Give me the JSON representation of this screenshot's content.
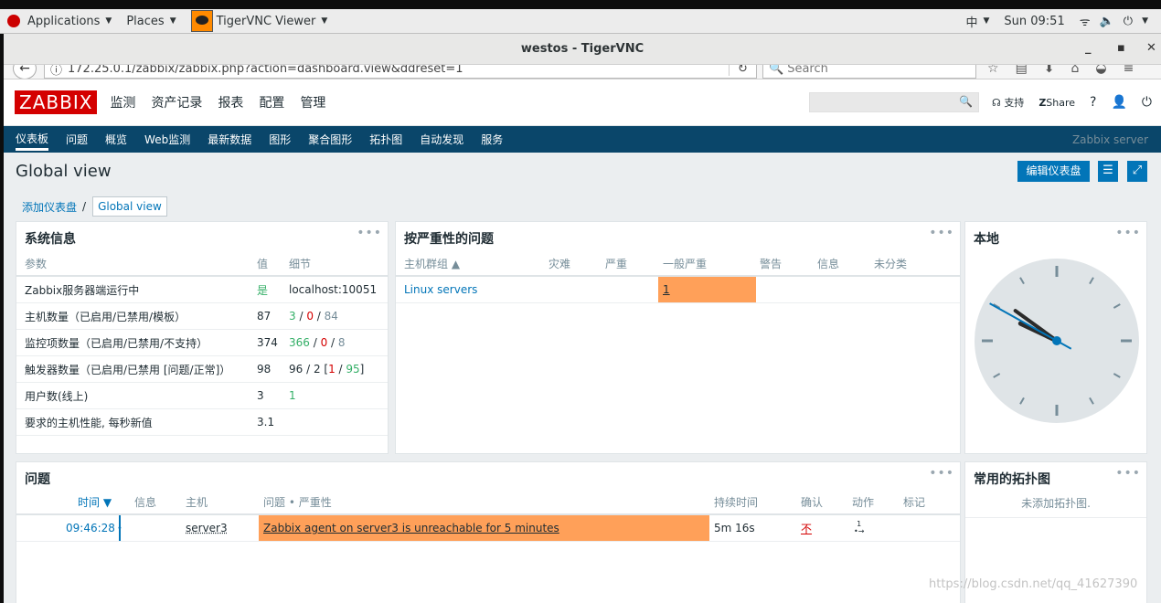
{
  "topbar": {
    "applications": "Applications",
    "places": "Places",
    "window_app": "TigerVNC Viewer",
    "input_method": "中",
    "datetime": "Sun 09:51"
  },
  "window": {
    "title": "westos - TigerVNC"
  },
  "browser": {
    "url": "172.25.0.1/zabbix/zabbix.php?action=dashboard.view&ddreset=1",
    "search_placeholder": "Search"
  },
  "zabbix": {
    "logo": "ZABBIX",
    "main_menu": [
      "监测",
      "资产记录",
      "报表",
      "配置",
      "管理"
    ],
    "header_right": {
      "support": "支持",
      "share": "Share",
      "help": "?"
    },
    "sub_menu": [
      "仪表板",
      "问题",
      "概览",
      "Web监测",
      "最新数据",
      "图形",
      "聚合图形",
      "拓扑图",
      "自动发现",
      "服务"
    ],
    "server_name": "Zabbix server",
    "page_title": "Global view",
    "edit_button": "编辑仪表盘",
    "breadcrumb": {
      "parent": "添加仪表盘",
      "separator": "/",
      "current": "Global view"
    }
  },
  "widgets": {
    "system_info": {
      "title": "系统信息",
      "headers": {
        "param": "参数",
        "value": "值",
        "details": "细节"
      },
      "rows": [
        {
          "param": "Zabbix服务器端运行中",
          "value": "是",
          "detail_text": "localhost:10051"
        },
        {
          "param": "主机数量（已启用/已禁用/模板）",
          "value": "87",
          "d1": "3",
          "d2": "0",
          "d3": "84"
        },
        {
          "param": "监控项数量（已启用/已禁用/不支持）",
          "value": "374",
          "d1": "366",
          "d2": "0",
          "d3": "8"
        },
        {
          "param": "触发器数量（已启用/已禁用 [问题/正常]）",
          "value": "98",
          "d_prefix": "96 / 2 [",
          "d1": "1",
          "d2": "95",
          "d_suffix": "]"
        },
        {
          "param": "用户数(线上)",
          "value": "3",
          "d1": "1"
        },
        {
          "param": "要求的主机性能, 每秒新值",
          "value": "3.1"
        }
      ]
    },
    "problems_by_severity": {
      "title": "按严重性的问题",
      "headers": [
        "主机群组 ▲",
        "灾难",
        "严重",
        "一般严重",
        "警告",
        "信息",
        "未分类"
      ],
      "rows": [
        {
          "group": "Linux servers",
          "average": "1"
        }
      ]
    },
    "local_clock": {
      "title": "本地",
      "hour": 9,
      "minute": 51
    },
    "problems": {
      "title": "问题",
      "headers": {
        "time": "时间 ▼",
        "info": "信息",
        "host": "主机",
        "problem": "问题 • 严重性",
        "duration": "持续时间",
        "ack": "确认",
        "actions": "动作",
        "tags": "标记"
      },
      "rows": [
        {
          "time": "09:46:28",
          "host": "server3",
          "problem": "Zabbix agent on server3 is unreachable for 5 minutes",
          "duration": "5m 16s",
          "ack": "不",
          "actions": "1"
        }
      ]
    },
    "favorite_maps": {
      "title": "常用的拓扑图",
      "empty_text": "未添加拓扑图."
    }
  },
  "watermark": "https://blog.csdn.net/qq_41627390",
  "colors": {
    "severity_average": "#ffa059",
    "zabbix_red": "#d40000",
    "nav_blue": "#0a466a",
    "button_blue": "#0275b8"
  }
}
